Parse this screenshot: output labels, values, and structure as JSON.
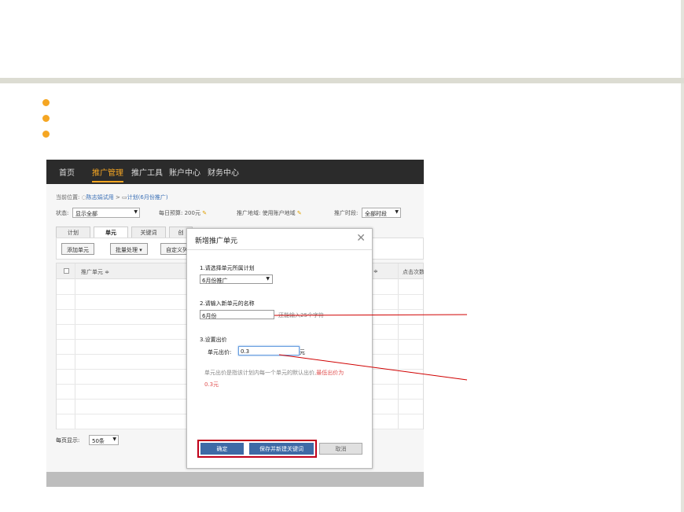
{
  "colors": {
    "bullet": "#f5a623",
    "nav_bg": "#2b2b2b",
    "nav_active": "#f5a623",
    "primary_button": "#3e6aa6",
    "highlight_box": "#c0001a",
    "annotation_line": "#d00000",
    "warning_text": "#e05050"
  },
  "app": {
    "nav": [
      "首页",
      "推广管理",
      "推广工具",
      "账户中心",
      "财务中心"
    ],
    "nav_active_index": 1,
    "breadcrumb": {
      "prefix": "当前位置:",
      "account": "陈志娟试用",
      "separator": ">",
      "plan": "计划(6月份推广)"
    },
    "status": {
      "label": "状态:",
      "value": "显示全部",
      "budget_label": "每日预算:",
      "budget_value": "200元",
      "region_label": "推广地域:",
      "region_value": "使用账户地域",
      "time_label": "推广时段:",
      "time_value": "全部时段"
    },
    "tabs": [
      "计划",
      "单元",
      "关键词",
      "创"
    ],
    "active_tab_index": 1,
    "toolbar": {
      "add_unit": "添加单元",
      "batch": "批量处理",
      "custom": "自定义列"
    },
    "grid": {
      "col_name": "推广单元",
      "col_sort": "≑",
      "col_clicks": "点击次数"
    },
    "pager": {
      "label": "每页显示:",
      "value": "50条"
    }
  },
  "dialog": {
    "title": "新增推广单元",
    "close": "✕",
    "step1_label": "1.请选择单元所属计划",
    "plan_value": "6月份推广",
    "step2_label": "2.请输入新单元的名称",
    "name_value": "6月份",
    "name_hint": "还能输入25个字符",
    "step3_label": "3.设置出价",
    "bid_label": "单元出价:",
    "bid_value": "0.3",
    "bid_unit": "元",
    "note": "单元出价是指该计划内每一个单元的默认出价,",
    "note_red_1": "最低出价为",
    "note_red_2": "0.3元",
    "confirm": "确定",
    "save_and_new": "保存并新建关键词",
    "cancel": "取消"
  }
}
